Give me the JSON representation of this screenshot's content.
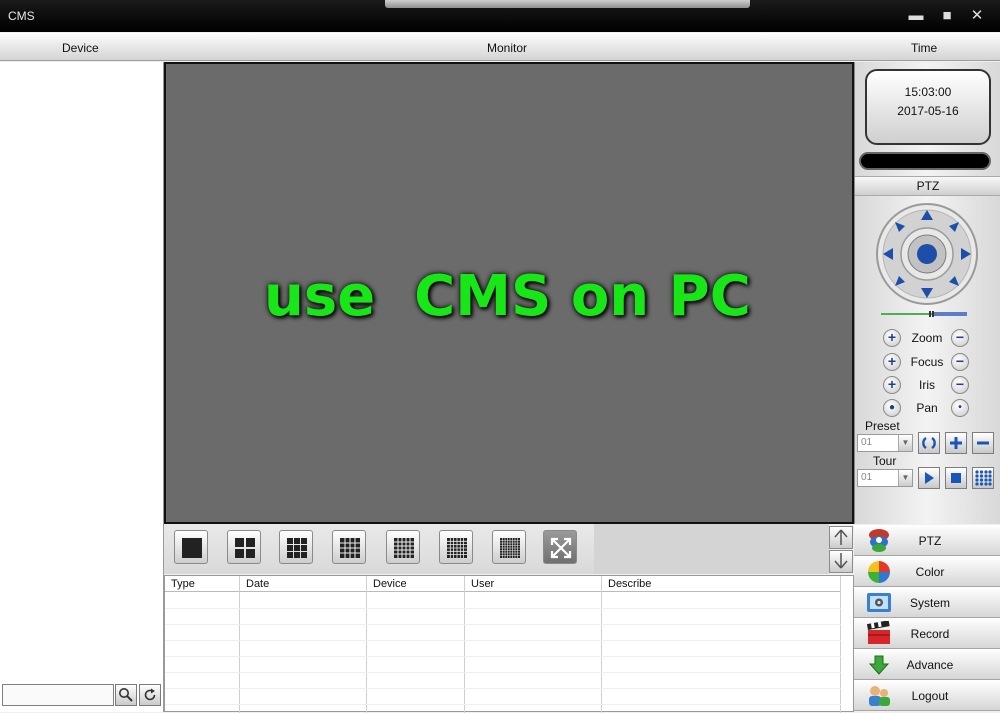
{
  "window": {
    "title": "CMS",
    "minimize_glyph": "▬",
    "maximize_glyph": "■",
    "close_glyph": "✕"
  },
  "header": {
    "device": "Device",
    "monitor": "Monitor",
    "time": "Time"
  },
  "monitor": {
    "overlay_text": "use  CMS on PC",
    "overlay_color": "#19e619",
    "background": "#6b6b6b"
  },
  "clock": {
    "time": "15:03:00",
    "date": "2017-05-16"
  },
  "ptz": {
    "title": "PTZ",
    "rows": [
      {
        "label": "Zoom",
        "left": "+",
        "right": "−"
      },
      {
        "label": "Focus",
        "left": "+",
        "right": "−"
      },
      {
        "label": "Iris",
        "left": "+",
        "right": "−"
      },
      {
        "label": "Pan",
        "left": "●",
        "right": "•"
      }
    ],
    "preset_label": "Preset",
    "preset_value": "01",
    "tour_label": "Tour",
    "tour_value": "01"
  },
  "search": {
    "placeholder": ""
  },
  "log_table": {
    "columns": [
      "Type",
      "Date",
      "Device",
      "User",
      "Describe"
    ],
    "rows": []
  },
  "menu": [
    {
      "label": "PTZ",
      "icon": "ptz-icon"
    },
    {
      "label": "Color",
      "icon": "color-icon"
    },
    {
      "label": "System",
      "icon": "system-icon"
    },
    {
      "label": "Record",
      "icon": "record-icon"
    },
    {
      "label": "Advance",
      "icon": "advance-icon"
    },
    {
      "label": "Logout",
      "icon": "logout-icon"
    }
  ],
  "colors": {
    "accent": "#1a55b8",
    "titlebar": "#000000"
  }
}
